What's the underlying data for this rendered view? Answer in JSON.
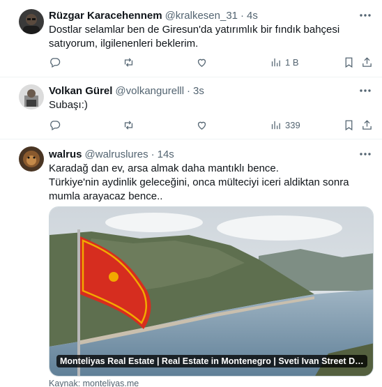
{
  "tweets": [
    {
      "name": "Rüzgar Karacehennem",
      "handle": "@kralkesen_31",
      "dot": "·",
      "time": "4s",
      "text": "Dostlar selamlar ben de Giresun'da yatırımlık bir fındık bahçesi satıyorum, ilgilenenleri beklerim.",
      "views": "1 B"
    },
    {
      "name": "Volkan Gürel",
      "handle": "@volkangurelll",
      "dot": "·",
      "time": "3s",
      "text": "Subaşı:)",
      "views": "339"
    },
    {
      "name": "walrus",
      "handle": "@walruslures",
      "dot": "·",
      "time": "14s",
      "text_line1": "Karadağ dan ev, arsa almak daha mantıklı bence.",
      "text_line2": "Türkiye'nin aydinlik geleceğini, onca mülteciyi iceri aldiktan sonra mumla arayacaz bence..",
      "card_title": "Monteliyas Real Estate | Real Estate in Montenegro | Sveti Ivan Street Dobrota, Kotor",
      "card_source": "Kaynak: monteliyas.me"
    }
  ],
  "icons": [
    "reply-icon",
    "retweet-icon",
    "like-icon",
    "views-icon",
    "bookmark-icon",
    "share-icon",
    "more-icon"
  ],
  "colors": {
    "text": "#0f1419",
    "secondary": "#536471",
    "border": "#eff3f4",
    "flag_red": "#d62d1f",
    "flag_gold": "#f2a900"
  }
}
